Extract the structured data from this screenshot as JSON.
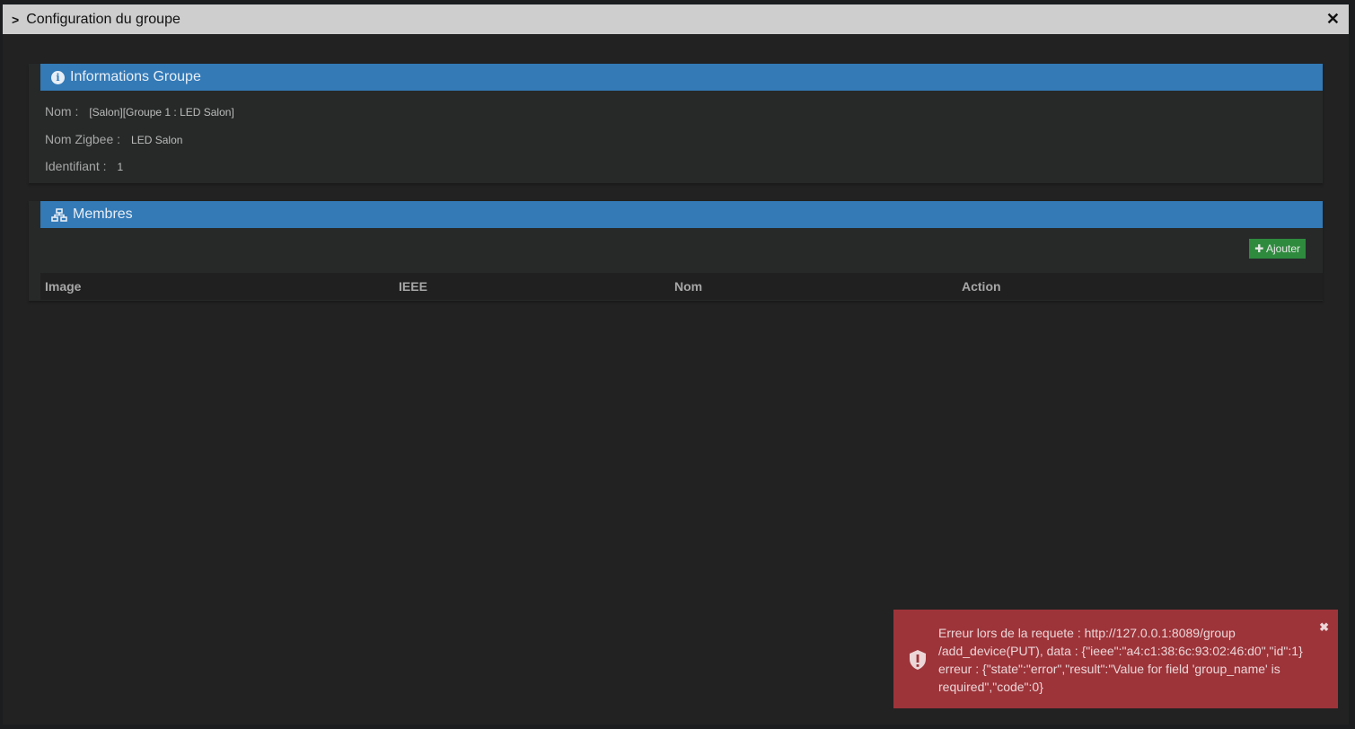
{
  "modal": {
    "title": "Configuration du groupe"
  },
  "info": {
    "title": "Informations Groupe",
    "rows": [
      {
        "label": "Nom :",
        "value": "[Salon][Groupe 1 : LED Salon]"
      },
      {
        "label": "Nom Zigbee :",
        "value": "LED Salon"
      },
      {
        "label": "Identifiant :",
        "value": "1"
      }
    ]
  },
  "members": {
    "title": "Membres",
    "add_label": "Ajouter",
    "columns": [
      "Image",
      "IEEE",
      "Nom",
      "Action"
    ]
  },
  "toast": {
    "lines": [
      "Erreur lors de la requete : http://127.0.0.1:8089/group",
      "/add_device(PUT), data : {\"ieee\":\"a4:c1:38:6c:93:02:46:d0\",\"id\":1}",
      "erreur : {\"state\":\"error\",\"result\":\"Value for field 'group_name' is",
      "required\",\"code\":0}"
    ]
  }
}
